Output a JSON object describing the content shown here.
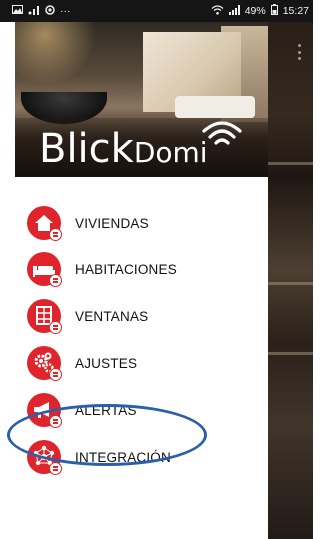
{
  "status_bar": {
    "battery_percent": "49%",
    "time": "15:27",
    "left_icons": [
      "image-icon",
      "signal-bars-icon",
      "circle-icon",
      "more-dots-icon"
    ],
    "right_icons": [
      "wifi-icon",
      "cell-signal-icon",
      "battery-icon"
    ],
    "more": "···"
  },
  "drawer": {
    "header": {
      "logo_part1": "Blick",
      "logo_part2": "Domi",
      "logo_icon": "wifi-signal-icon"
    },
    "menu": [
      {
        "label": "VIVIENDAS",
        "icon": "house-icon"
      },
      {
        "label": "HABITACIONES",
        "icon": "bed-icon"
      },
      {
        "label": "VENTANAS",
        "icon": "window-icon"
      },
      {
        "label": "AJUSTES",
        "icon": "gears-icon"
      },
      {
        "label": "ALERTAS",
        "icon": "megaphone-icon"
      },
      {
        "label": "INTEGRACIÓN",
        "icon": "network-icon",
        "highlighted": true
      }
    ]
  },
  "colors": {
    "accent": "#e0242b",
    "highlight_outline": "#2a5fb0"
  }
}
